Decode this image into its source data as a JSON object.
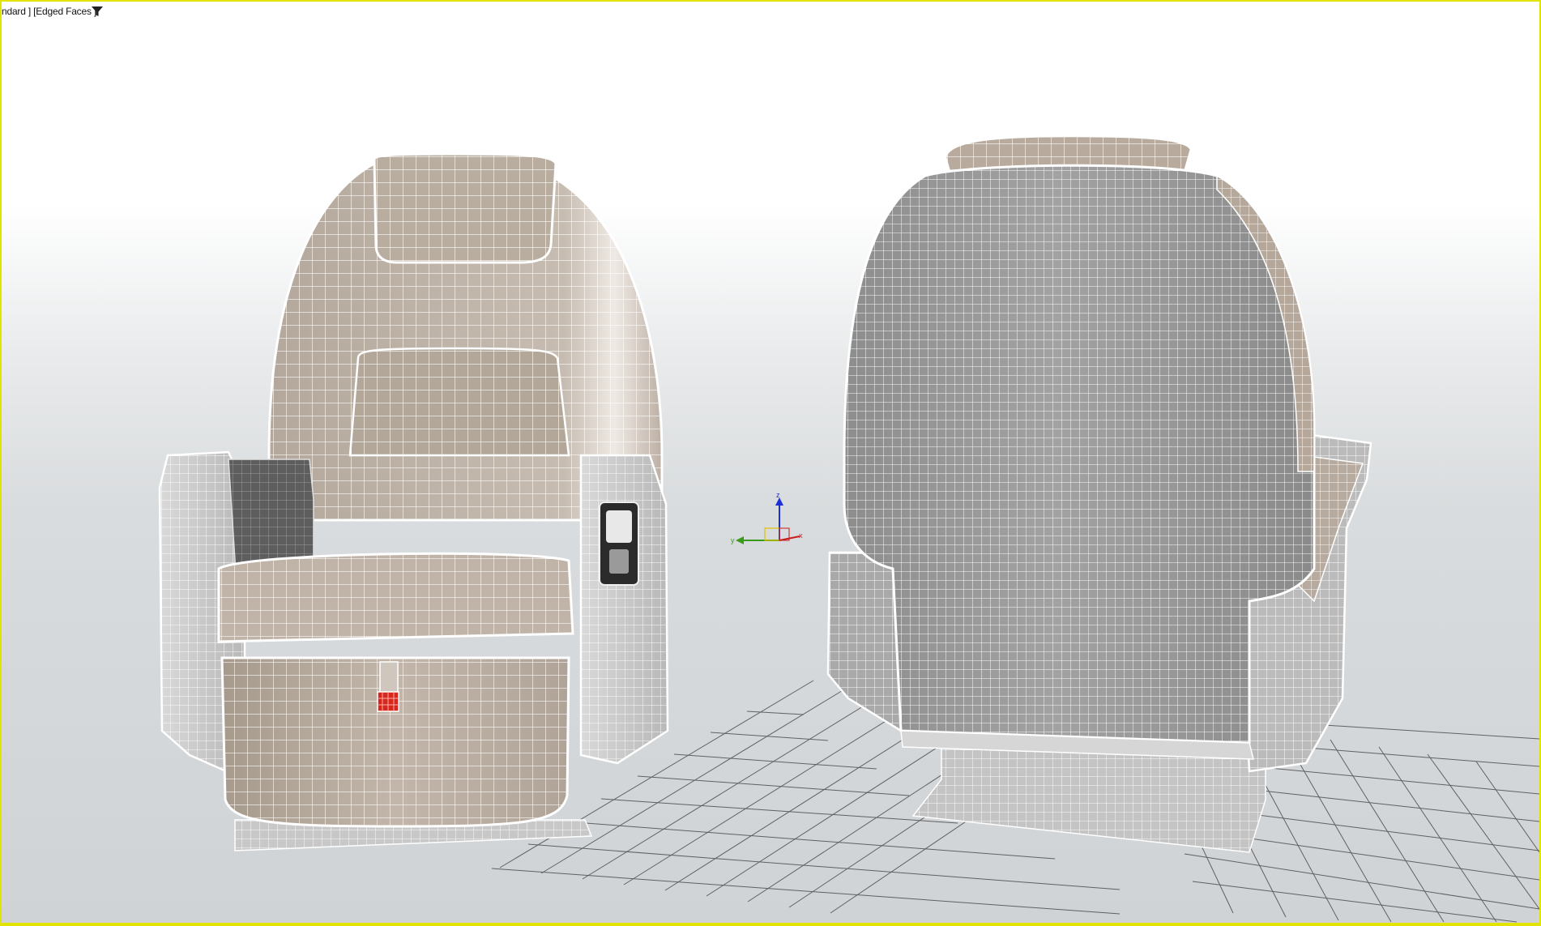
{
  "viewport": {
    "label_prefix": "ndard ]",
    "label_mode": "[Edged Faces ]",
    "filter_icon": "filter-funnel-icon",
    "border_color": "#e3e300"
  },
  "scene": {
    "objects": [
      "front-facing-seat",
      "rear-facing-seat",
      "axis-gizmo",
      "home-grid"
    ],
    "gizmo_axes": {
      "z_label": "z",
      "y_label": "y",
      "x_label": "x"
    },
    "material_color": "#b7ab9f",
    "rear_material_color": "#9b9b9b"
  }
}
